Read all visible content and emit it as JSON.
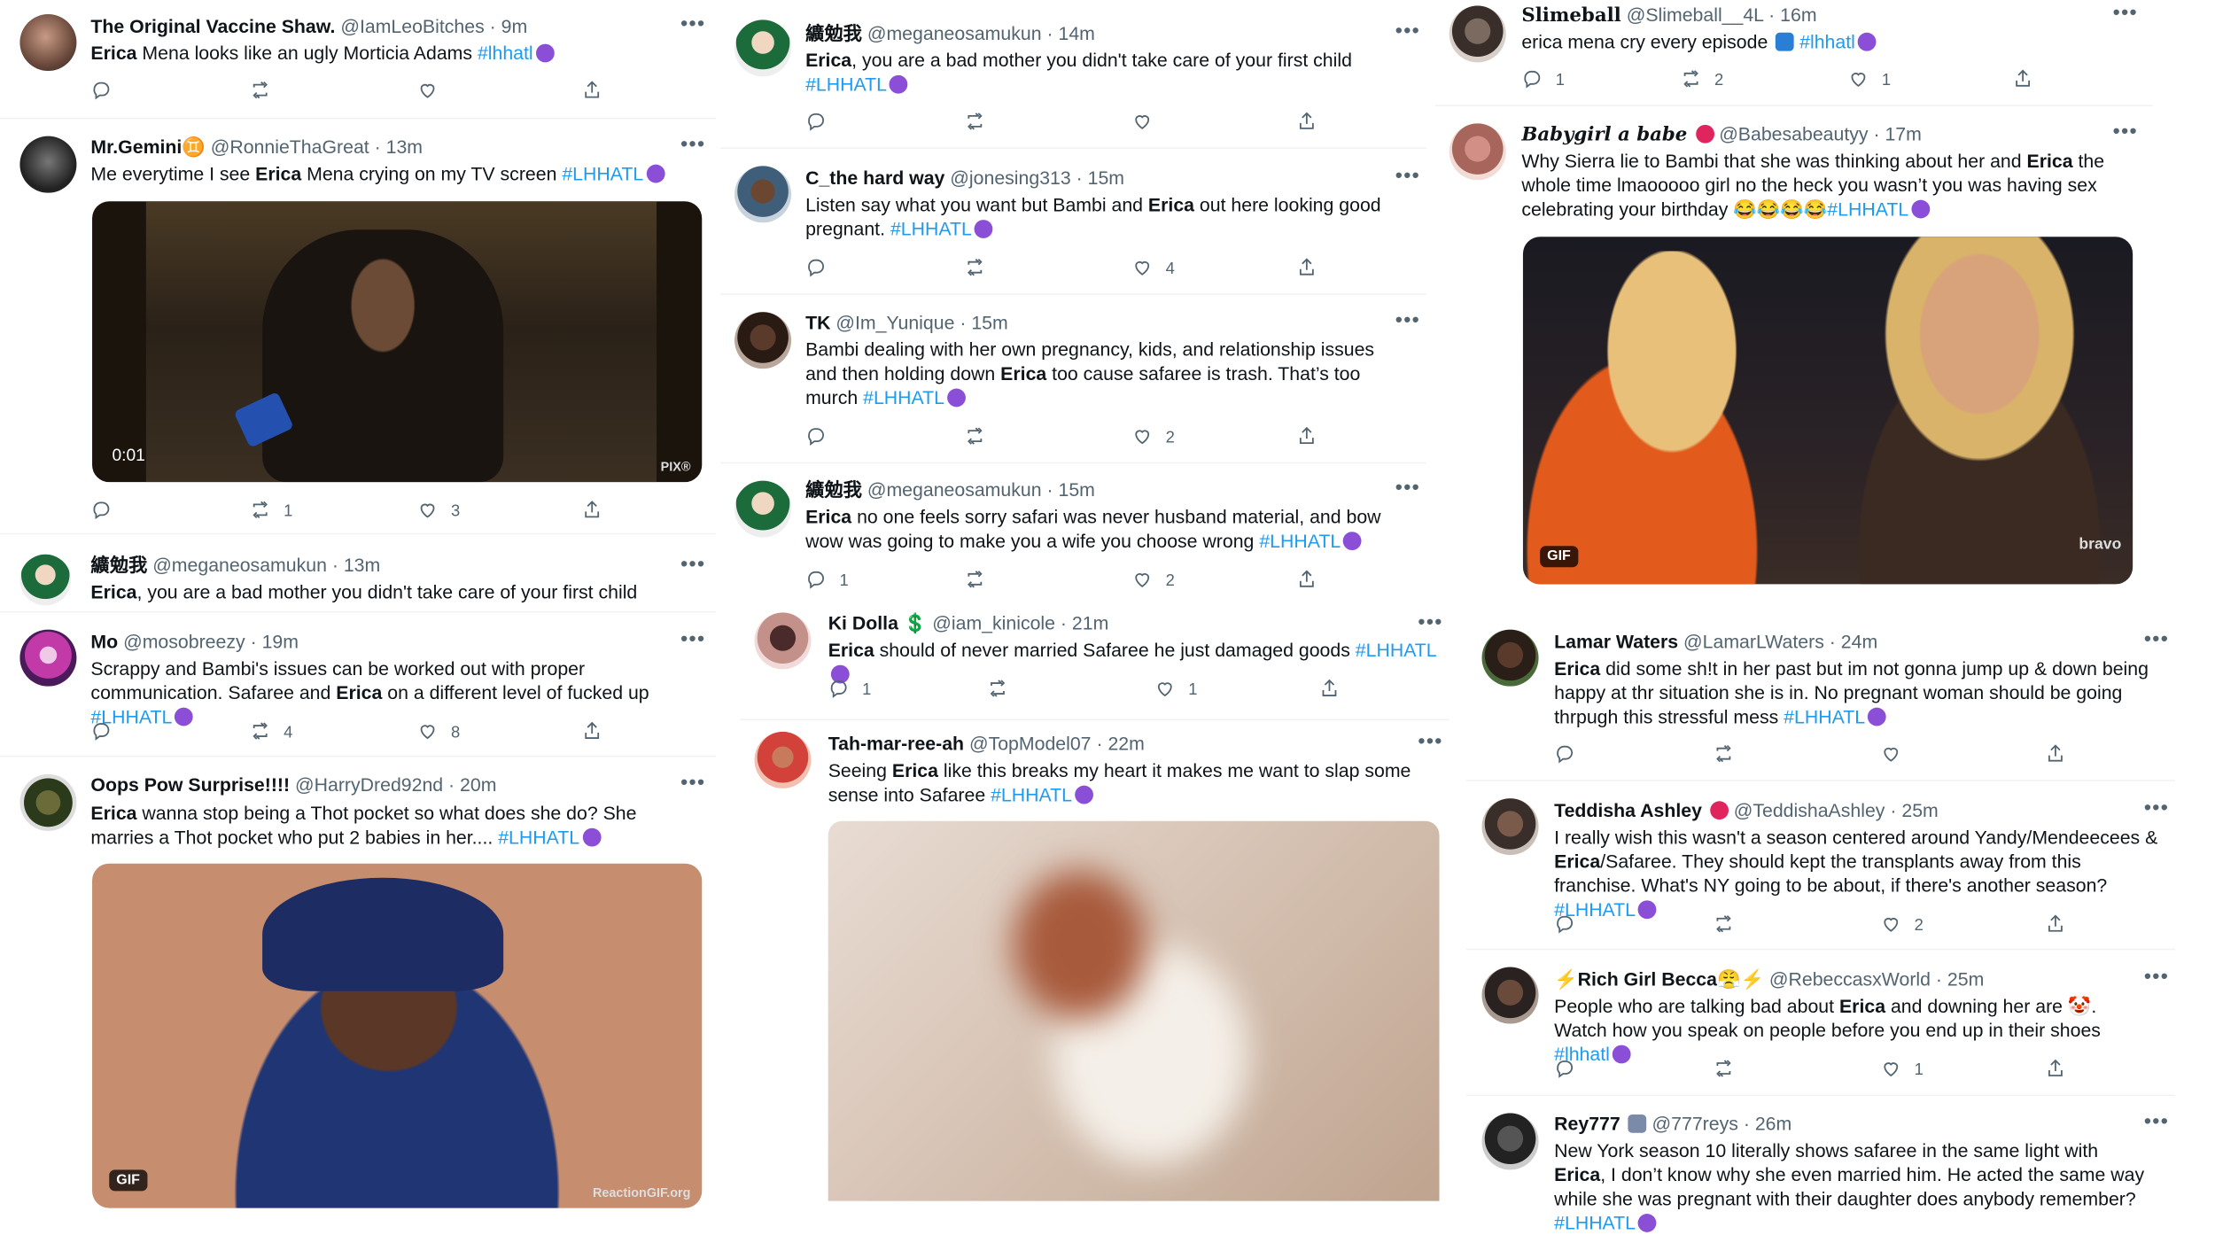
{
  "colors": {
    "link": "#1d9bf0",
    "text": "#0f1419",
    "muted": "#536471",
    "verified_heart": "#e0245e"
  },
  "icons": [
    "more-dots-icon",
    "reply-icon",
    "retweet-icon",
    "like-icon",
    "share-icon",
    "headphones-emoji-icon"
  ],
  "tweets": {
    "t1": {
      "name": "The Original Vaccine Shaw.",
      "handle": "@IamLeoBitches",
      "time": "· 9m",
      "text_a": "Mena looks like an ugly Morticia Adams ",
      "hashtag": "#lhhatl",
      "replies": "",
      "retweets": "",
      "likes": ""
    },
    "t2": {
      "name": "Mr.Gemini♊",
      "handle": "@RonnieThaGreat",
      "time": "· 13m",
      "text_a": "Me everytime I see ",
      "text_b": " Mena crying on my TV screen ",
      "hashtag": "#LHHATL",
      "video_time": "0:01",
      "watermark": "PIX®",
      "mic_label": "PIX®",
      "replies": "",
      "retweets": "1",
      "likes": "3"
    },
    "t3": {
      "name": "纊勉我",
      "handle": "@meganeosamukun",
      "time": "· 13m",
      "text_a": ", you are a bad mother you didn't take care of your first child"
    },
    "t4": {
      "name": "Mo",
      "handle": "@mosobreezy",
      "time": "· 19m",
      "text_a": "Scrappy and Bambi's issues can be worked out with proper communication. Safaree and ",
      "text_b": " on a different level of fucked up ",
      "hashtag": "#LHHATL",
      "replies": "",
      "retweets": "4",
      "likes": "8"
    },
    "t5": {
      "name": "Oops Pow Surprise!!!!",
      "handle": "@HarryDred92nd",
      "time": "· 20m",
      "text_a": " wanna stop being a Thot pocket so what does she do? She marries a Thot pocket who put 2 babies in her.... ",
      "hashtag": "#LHHATL",
      "gif": "GIF",
      "watermark": "ReactionGIF.org"
    },
    "m1": {
      "name": "纊勉我",
      "handle": "@meganeosamukun",
      "time": "· 14m",
      "text_a": ", you are a bad mother you didn't take care of your first child ",
      "hashtag": "#LHHATL",
      "replies": "",
      "retweets": "",
      "likes": ""
    },
    "m2": {
      "name": "C_the hard way",
      "handle": "@jonesing313",
      "time": "· 15m",
      "text_a": "Listen say what you want but Bambi and ",
      "text_b": " out here looking good pregnant. ",
      "hashtag": "#LHHATL",
      "replies": "",
      "retweets": "",
      "likes": "4"
    },
    "m3": {
      "name": "TK",
      "handle": "@Im_Yunique",
      "time": "· 15m",
      "text_a": "Bambi dealing with her own pregnancy, kids, and relationship issues and then holding down ",
      "text_b": " too cause safaree is trash. That’s too murch ",
      "hashtag": "#LHHATL",
      "replies": "",
      "retweets": "",
      "likes": "2"
    },
    "m4": {
      "name": "纊勉我",
      "handle": "@meganeosamukun",
      "time": "· 15m",
      "text_a": " no one feels sorry safari was never husband material, and bow wow was going to make you a wife you choose wrong ",
      "hashtag": "#LHHATL",
      "replies": "1",
      "retweets": "",
      "likes": "2"
    },
    "m5": {
      "name": "Ki Dolla 💲",
      "handle": "@iam_kinicole",
      "time": "· 21m",
      "text_a": " should of never married Safaree he just damaged goods ",
      "hashtag": "#LHHATL",
      "replies": "1",
      "retweets": "",
      "likes": "1"
    },
    "m6": {
      "name": "Tah-mar-ree-ah",
      "handle": "@TopModel07",
      "time": "· 22m",
      "text_a": "Seeing ",
      "text_b": " like this breaks my heart it makes me want to slap some sense into Safaree ",
      "hashtag": "#LHHATL"
    },
    "r1": {
      "name": "Slimeball",
      "handle": "@Slimeball__4L",
      "time": "· 16m",
      "text_a": "erica mena cry every episode ",
      "hashtag": "#lhhatl",
      "replies": "1",
      "retweets": "2",
      "likes": "1"
    },
    "r2": {
      "name": "Babygirl a babe",
      "handle": "@Babesabeautyy",
      "time": "· 17m",
      "text_a": "Why Sierra lie to Bambi that she was thinking about her and ",
      "text_b": " the whole time lmaooooo girl no the heck you wasn’t you was having sex celebrating your birthday 😂😂😂😂",
      "hashtag": "#LHHATL",
      "gif": "GIF",
      "watermark": "bravo"
    },
    "r3": {
      "name": "Lamar Waters",
      "handle": "@LamarLWaters",
      "time": "· 24m",
      "text_a": " did some sh!t in her past but im not gonna jump up & down being happy at thr situation she is in. No pregnant woman should be going thrpugh this stressful mess ",
      "hashtag": "#LHHATL",
      "replies": "",
      "retweets": "",
      "likes": ""
    },
    "r4": {
      "name": "Teddisha Ashley",
      "handle": "@TeddishaAshley",
      "time": "· 25m",
      "text_a": "I really wish this wasn't a season centered around Yandy/Mendeecees & ",
      "text_b": "/Safaree. They should kept the transplants away from this franchise. What's NY going to be about, if there's another season? ",
      "hashtag": "#LHHATL",
      "replies": "",
      "retweets": "",
      "likes": "2"
    },
    "r5": {
      "name": "⚡Rich Girl Becca😤⚡",
      "handle": "@RebeccasxWorld",
      "time": "· 25m",
      "text_a": "People who are talking bad about ",
      "text_b": " and downing her are 🤡. Watch how you speak on people before you end up in their shoes ",
      "hashtag": "#lhhatl",
      "replies": "",
      "retweets": "",
      "likes": "1"
    },
    "r6": {
      "name": "Rey777",
      "handle": "@777reys",
      "time": "· 26m",
      "text_a": "New York season 10 literally shows safaree in the same light with ",
      "text_b": ", I don’t know why she even married him. He acted the same way while she was pregnant with their daughter does anybody remember? ",
      "hashtag": "#LHHATL"
    }
  },
  "keyword": "Erica",
  "dots": "•••"
}
